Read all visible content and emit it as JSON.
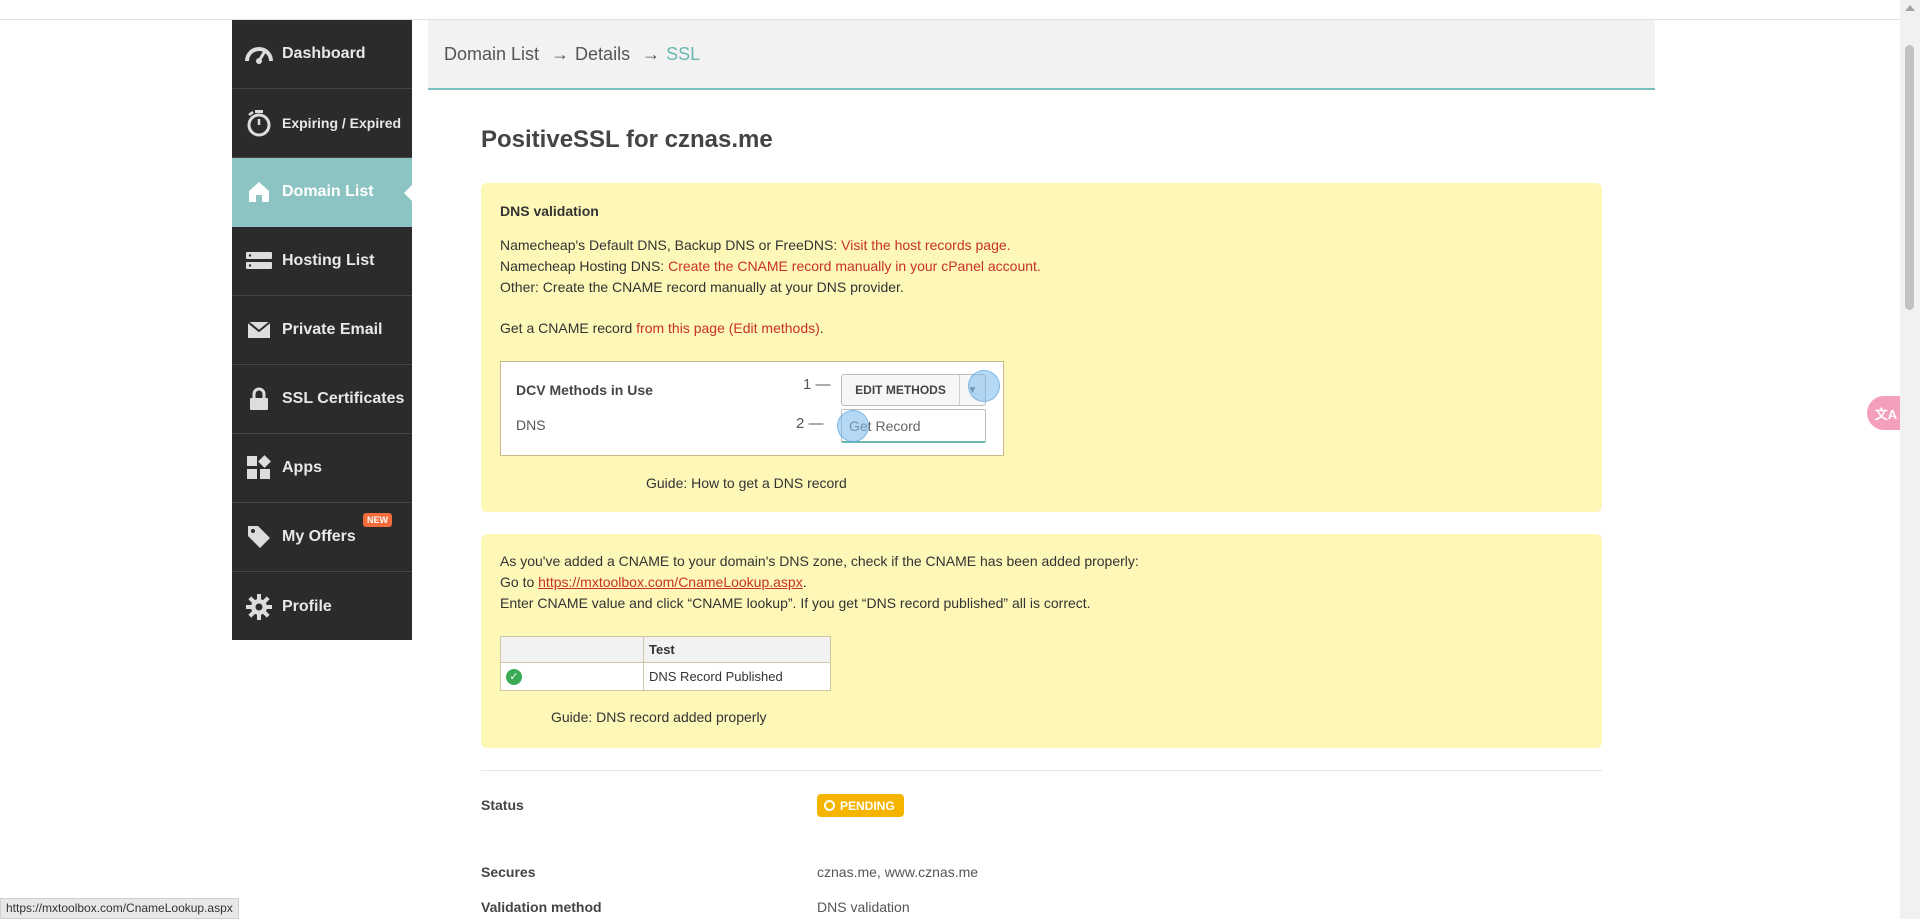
{
  "sidebar": {
    "items": [
      {
        "label": "Dashboard",
        "icon": "dashboard-gauge-icon"
      },
      {
        "label": "Expiring / Expired",
        "icon": "timer-icon"
      },
      {
        "label": "Domain List",
        "icon": "home-icon",
        "active": true
      },
      {
        "label": "Hosting List",
        "icon": "server-icon"
      },
      {
        "label": "Private Email",
        "icon": "envelope-icon"
      },
      {
        "label": "SSL Certificates",
        "icon": "lock-icon"
      },
      {
        "label": "Apps",
        "icon": "apps-grid-icon"
      },
      {
        "label": "My Offers",
        "icon": "tag-icon",
        "badge": "NEW"
      },
      {
        "label": "Profile",
        "icon": "gear-icon"
      }
    ]
  },
  "breadcrumb": {
    "root": "Domain List",
    "arrow": "→",
    "middle": "Details",
    "current": "SSL"
  },
  "page_title": "PositiveSSL for cznas.me",
  "dns_validation": {
    "heading": "DNS validation",
    "line1_prefix": "Namecheap's Default DNS, Backup DNS or FreeDNS: ",
    "line1_link": "Visit the host records page.",
    "line2_prefix": "Namecheap Hosting DNS: ",
    "line2_link": "Create the CNAME record manually in your cPanel account.",
    "line3": "Other: Create the CNAME record manually at your DNS provider.",
    "line4_prefix": "Get a CNAME record ",
    "line4_link": "from this page (Edit methods)",
    "line4_suffix": ".",
    "dcv": {
      "title": "DCV Methods in Use",
      "method": "DNS",
      "step1": "1 —",
      "step2": "2 —",
      "edit_button": "EDIT METHODS",
      "get_record": "Get Record"
    },
    "guide": "Guide: How to get a DNS record"
  },
  "cname_check": {
    "line1": "As you've added a CNAME to your domain's DNS zone, check if the CNAME has been added properly:",
    "line2_prefix": "Go to ",
    "line2_link": "https://mxtoolbox.com/CnameLookup.aspx",
    "line2_suffix": ".",
    "line3": "Enter CNAME value and click “CNAME lookup”. If you get “DNS record published” all is correct.",
    "table": {
      "header": "Test",
      "row": "DNS Record Published"
    },
    "guide": "Guide: DNS record added properly"
  },
  "details": {
    "status_label": "Status",
    "status_value": "PENDING",
    "secures_label": "Secures",
    "secures_value": "cznas.me, www.cznas.me",
    "validation_label": "Validation method",
    "validation_value": "DNS validation"
  },
  "status_bar_url": "https://mxtoolbox.com/CnameLookup.aspx",
  "translate_button": "文A",
  "colors": {
    "sidebar_bg": "#2b2b2b",
    "active_item": "#8bc4c2",
    "panel_bg": "#fdf7b8",
    "link_red": "#c9302c",
    "pending": "#f4b400"
  }
}
